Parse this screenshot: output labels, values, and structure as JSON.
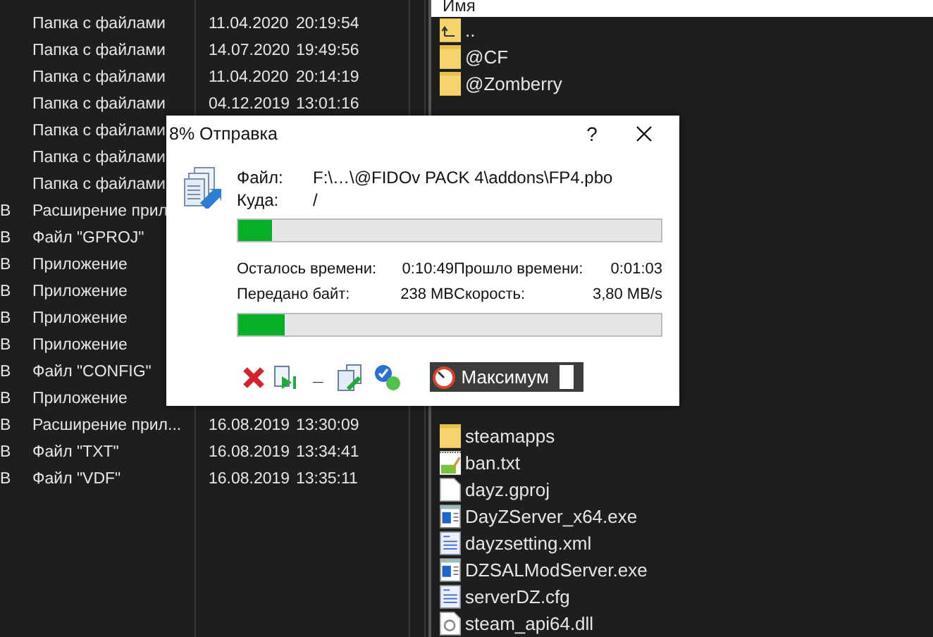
{
  "left_panel": {
    "rows": [
      {
        "type": "Папка с файлами",
        "date": "11.04.2020",
        "time": "20:19:54"
      },
      {
        "type": "Папка с файлами",
        "date": "14.07.2020",
        "time": "19:49:56"
      },
      {
        "type": "Папка с файлами",
        "date": "11.04.2020",
        "time": "20:14:19"
      },
      {
        "type": "Папка с файлами",
        "date": "04.12.2019",
        "time": "13:01:16"
      },
      {
        "type": "Папка с файлами"
      },
      {
        "type": "Папка с файлами"
      },
      {
        "type": "Папка с файлами"
      },
      {
        "size": "B",
        "type": "Расширение прил"
      },
      {
        "size": "B",
        "type": "Файл \"GPROJ\""
      },
      {
        "size": "B",
        "type": "Приложение"
      },
      {
        "size": "B",
        "type": "Приложение"
      },
      {
        "size": "B",
        "type": "Приложение"
      },
      {
        "size": "B",
        "type": "Приложение"
      },
      {
        "size": "B",
        "type": "Файл \"CONFIG\""
      },
      {
        "size": "B",
        "type": "Приложение"
      },
      {
        "size": "B",
        "type": "Расширение прил...",
        "date": "16.08.2019",
        "time": "13:30:09"
      },
      {
        "size": "B",
        "type": "Файл \"TXT\"",
        "date": "16.08.2019",
        "time": "13:34:41"
      },
      {
        "size": "B",
        "type": "Файл \"VDF\"",
        "date": "16.08.2019",
        "time": "13:35:11"
      }
    ]
  },
  "right_panel": {
    "column_header": "Имя",
    "files_above": [
      {
        "name": "..",
        "kind": "up"
      },
      {
        "name": "@CF",
        "kind": "folder"
      },
      {
        "name": "@Zomberry",
        "kind": "folder"
      }
    ],
    "files_below": [
      {
        "name": "steamapps",
        "kind": "folder"
      },
      {
        "name": "ban.txt",
        "kind": "text"
      },
      {
        "name": "dayz.gproj",
        "kind": "file"
      },
      {
        "name": "DayZServer_x64.exe",
        "kind": "exe"
      },
      {
        "name": "dayzsetting.xml",
        "kind": "doc"
      },
      {
        "name": "DZSALModServer.exe",
        "kind": "exe"
      },
      {
        "name": "serverDZ.cfg",
        "kind": "doc"
      },
      {
        "name": "steam_api64.dll",
        "kind": "dll"
      }
    ]
  },
  "dialog": {
    "title": "8% Отправка",
    "help": "?",
    "file_label": "Файл:",
    "file_value": "F:\\…\\@FIDOv PACK 4\\addons\\FP4.pbo",
    "target_label": "Куда:",
    "target_value": "/",
    "file_progress": {
      "level": 0.08
    },
    "stats": [
      {
        "label": "Осталось времени:",
        "value": "0:10:49"
      },
      {
        "label": "Прошло времени:",
        "value": "0:01:03"
      },
      {
        "label": "Передано байт:",
        "value": "238 MB"
      },
      {
        "label": "Скорость:",
        "value": "3,80 MB/s"
      }
    ],
    "total_progress": {
      "level": 0.11
    },
    "buttons": [
      {
        "kind": "cancel"
      },
      {
        "kind": "skip"
      },
      {
        "kind": "minimize",
        "label": "_"
      },
      {
        "kind": "background"
      },
      {
        "kind": "check"
      }
    ],
    "speed": {
      "label": "Максимум"
    }
  }
}
